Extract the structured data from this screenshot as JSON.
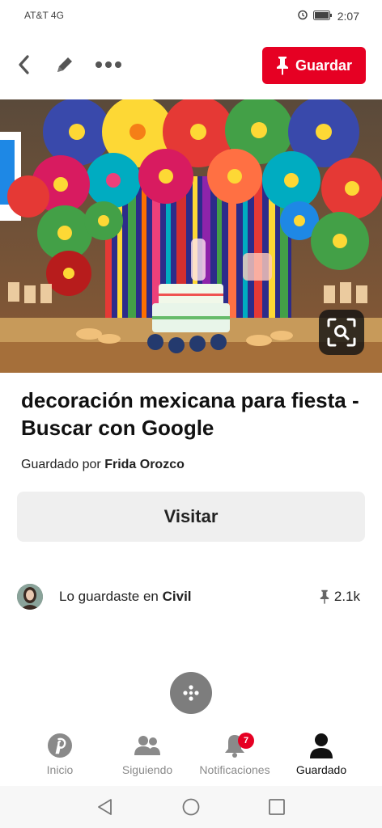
{
  "status": {
    "carrier": "AT&T 4G",
    "time": "2:07"
  },
  "toolbar": {
    "save_label": "Guardar"
  },
  "pin": {
    "title": "decoración mexicana para fiesta - Buscar con Google",
    "saved_by_prefix": "Guardado por",
    "saved_by_name": "Frida Orozco",
    "visit_label": "Visitar"
  },
  "board": {
    "prefix": "Lo guardaste en",
    "name": "Civil",
    "save_count": "2.1k"
  },
  "tabs": [
    {
      "label": "Inicio"
    },
    {
      "label": "Siguiendo"
    },
    {
      "label": "Notificaciones",
      "badge": "7"
    },
    {
      "label": "Guardado"
    }
  ],
  "colors": {
    "brand_red": "#e60023",
    "button_gray": "#efefef"
  }
}
